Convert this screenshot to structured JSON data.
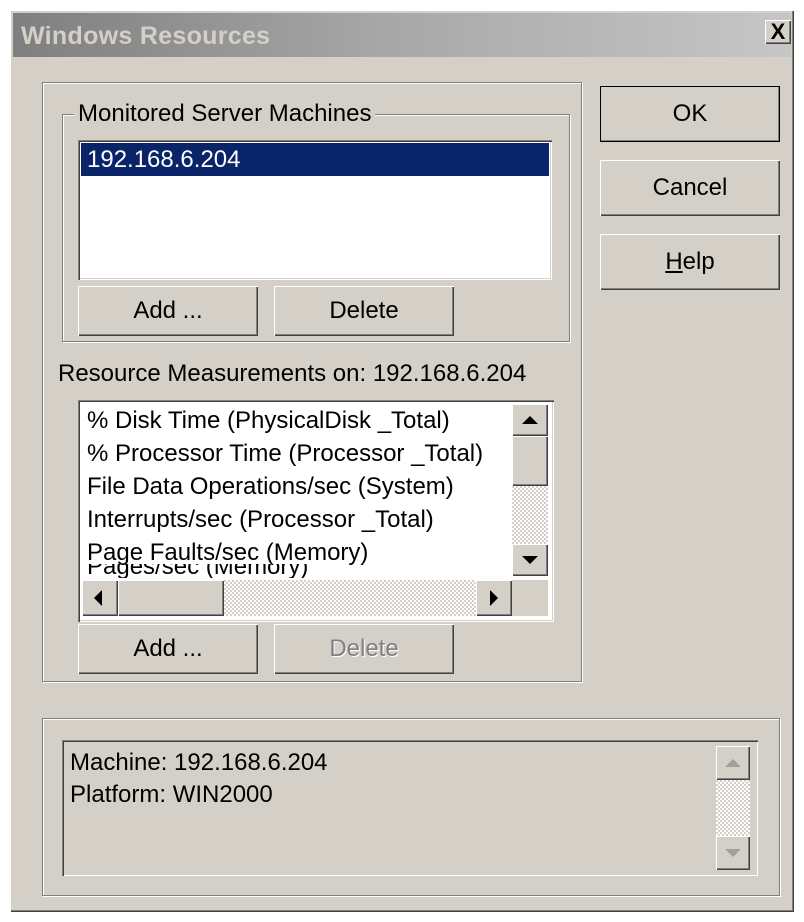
{
  "window": {
    "title": "Windows Resources",
    "close_label": "X"
  },
  "buttons": {
    "ok_label": "OK",
    "cancel_label": "Cancel",
    "help_prefix": "H",
    "help_rest": "elp"
  },
  "monitored": {
    "group_label": "Monitored Server Machines",
    "items": [
      "192.168.6.204"
    ],
    "selected_index": 0,
    "add_label": "Add ...",
    "delete_label": "Delete"
  },
  "measurements": {
    "label": "Resource Measurements on: 192.168.6.204",
    "items": [
      "% Disk Time (PhysicalDisk _Total)",
      "% Processor Time (Processor _Total)",
      "File Data Operations/sec (System)",
      "Interrupts/sec (Processor _Total)",
      "Page Faults/sec (Memory)",
      "Pages/sec (Memory)"
    ],
    "add_label": "Add ...",
    "delete_label": "Delete",
    "delete_enabled": false
  },
  "info": {
    "machine_line": "Machine: 192.168.6.204",
    "platform_line": "Platform: WIN2000"
  },
  "colors": {
    "face": "#d4d0c8",
    "selection": "#0a246a",
    "disabled_text": "#808080"
  }
}
